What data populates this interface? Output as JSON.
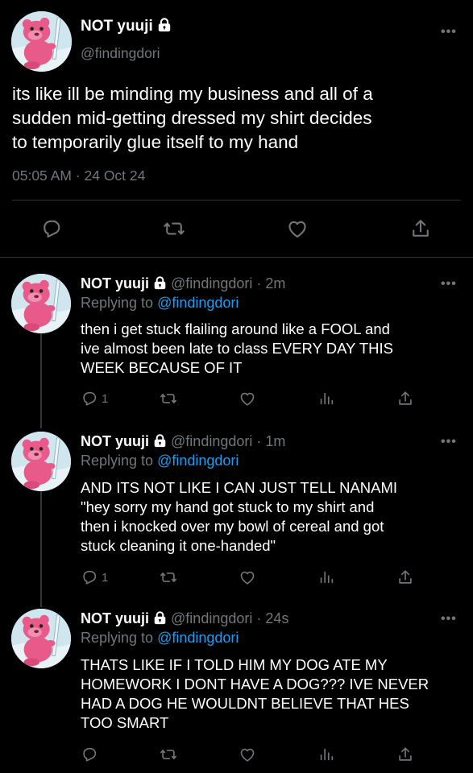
{
  "main": {
    "display_name": "NOT yuuji",
    "handle": "@findingdori",
    "text_lines": [
      "its like ill be minding my business and all of a",
      "sudden mid-getting dressed my shirt decides",
      "to temporarily glue itself to my hand"
    ],
    "timestamp": "05:05 AM · 24 Oct 24",
    "more": "•••"
  },
  "replies": [
    {
      "display_name": "NOT yuuji",
      "handle": "@findingdori",
      "time": "· 2m",
      "replying_prefix": "Replying to",
      "replying_to": "@findingdori",
      "text_lines": [
        "then i get stuck flailing around like a FOOL and",
        "ive almost been late to class EVERY DAY THIS",
        "WEEK BECAUSE OF IT"
      ],
      "reply_count": "1",
      "more": "•••"
    },
    {
      "display_name": "NOT yuuji",
      "handle": "@findingdori",
      "time": "· 1m",
      "replying_prefix": "Replying to",
      "replying_to": "@findingdori",
      "text_lines": [
        "AND ITS NOT LIKE I CAN JUST TELL NANAMI",
        "\"hey sorry my hand got stuck to my shirt and",
        "then i knocked over my bowl of cereal and got",
        "stuck cleaning it one-handed\""
      ],
      "reply_count": "1",
      "more": "•••"
    },
    {
      "display_name": "NOT yuuji",
      "handle": "@findingdori",
      "time": "· 24s",
      "replying_prefix": "Replying to",
      "replying_to": "@findingdori",
      "text_lines": [
        "THATS LIKE IF I TOLD HIM MY DOG ATE MY",
        "HOMEWORK I DONT HAVE A DOG??? IVE NEVER",
        "HAD A DOG HE WOULDNT BELIEVE THAT HES",
        "TOO SMART"
      ],
      "reply_count": "",
      "more": "•••"
    }
  ],
  "colors": {
    "background": "#000000",
    "text": "#ffffff",
    "muted": "#71767b",
    "link": "#1d9bf0",
    "divider": "#2f3336",
    "avatar_bg": "#cfe6ef",
    "avatar_character": "#e85a8a"
  },
  "icons": [
    "lock-icon",
    "reply-icon",
    "retweet-icon",
    "like-icon",
    "share-icon",
    "analytics-icon",
    "more-icon"
  ]
}
